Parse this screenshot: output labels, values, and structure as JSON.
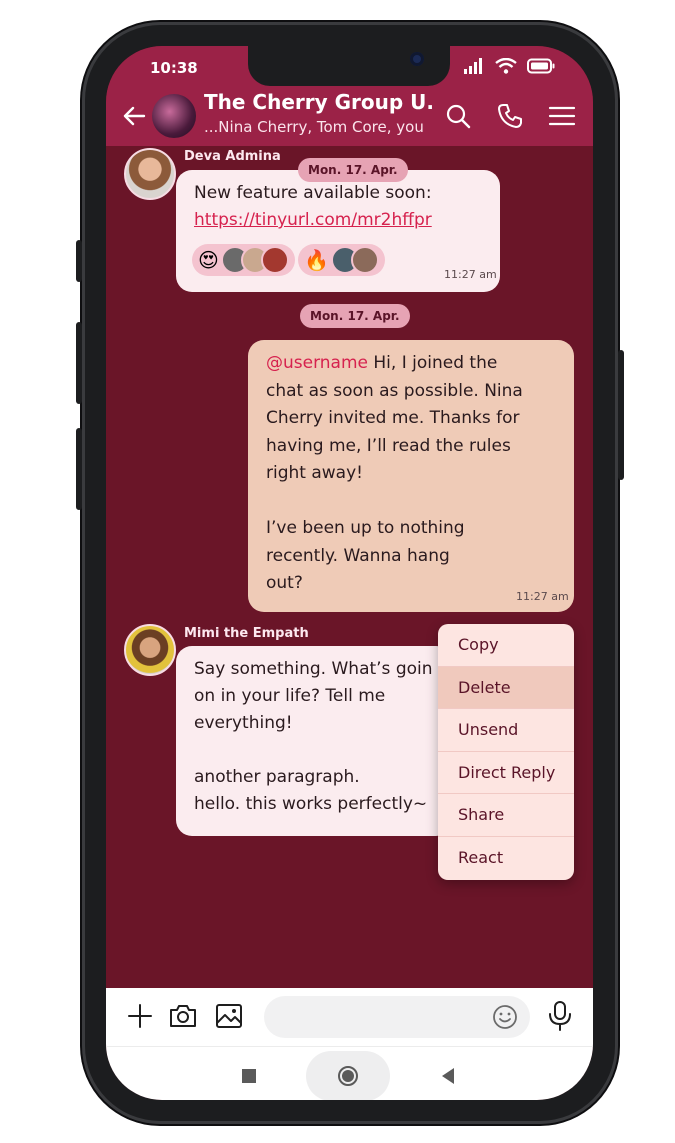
{
  "status_bar": {
    "time": "10:38"
  },
  "header": {
    "title": "The Cherry Group U...",
    "subtitle": "...Nina Cherry, Tom Core, you"
  },
  "messages": [
    {
      "sender": "Deva Admina",
      "date_pill": "Mon. 17. Apr.",
      "text": "New feature available soon:",
      "link": "https://tinyurl.com/mr2hffpr",
      "time": "11:27 am",
      "reactions": [
        {
          "emoji": "😍",
          "count_avatars": 3
        },
        {
          "emoji": "🔥",
          "count_avatars": 2
        }
      ]
    },
    {
      "date_pill": "Mon. 17. Apr.",
      "mention": "@username",
      "text_lines": [
        " Hi, I joined the",
        "chat as soon as possible. Nina",
        "Cherry invited me. Thanks for",
        "having me, I’ll read the rules",
        "right away!",
        "",
        "I’ve been up to nothing",
        "recently. Wanna hang",
        "out?"
      ],
      "time": "11:27 am"
    },
    {
      "sender": "Mimi the Empath",
      "text_lines": [
        "Say something. What’s goin",
        "on in your life? Tell me",
        "everything!",
        "",
        "another paragraph.",
        "hello. this works perfectly~"
      ]
    }
  ],
  "context_menu": {
    "items": [
      "Copy",
      "Delete",
      "Unsend",
      "Direct Reply",
      "Share",
      "React"
    ],
    "highlighted": "Delete"
  },
  "colors": {
    "header": "#9b2247",
    "chat_bg": "#6a1528",
    "incoming": "#fbecef",
    "outgoing": "#efcbb7",
    "accent": "#d6224e"
  }
}
